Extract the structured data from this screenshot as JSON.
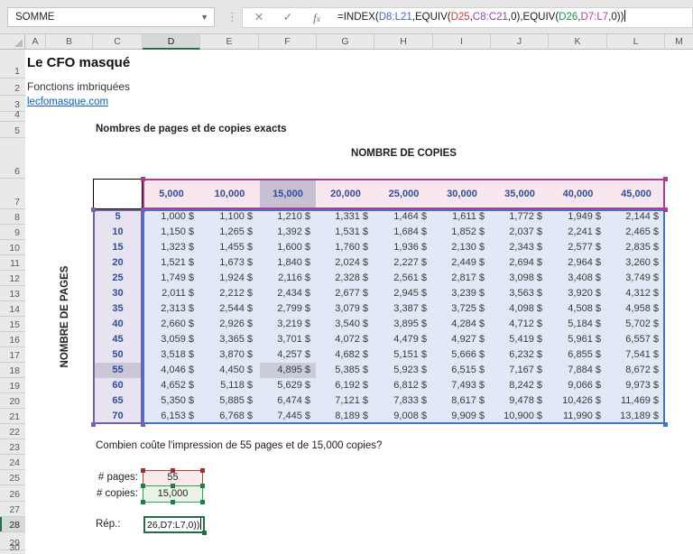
{
  "formula_bar": {
    "name_box_value": "SOMME",
    "segments": [
      {
        "text": "=INDEX(",
        "color": "default"
      },
      {
        "text": "D8:L21",
        "color": "blue"
      },
      {
        "text": ",EQUIV(",
        "color": "default"
      },
      {
        "text": "D25",
        "color": "red"
      },
      {
        "text": ",",
        "color": "default"
      },
      {
        "text": "C8:C21",
        "color": "purple"
      },
      {
        "text": ",0),EQUIV(",
        "color": "default"
      },
      {
        "text": "D26",
        "color": "green"
      },
      {
        "text": ",",
        "color": "default"
      },
      {
        "text": "D7:L7",
        "color": "magenta"
      },
      {
        "text": ",0))",
        "color": "default"
      }
    ]
  },
  "grid": {
    "columns": [
      "A",
      "B",
      "C",
      "D",
      "E",
      "F",
      "G",
      "H",
      "I",
      "J",
      "K",
      "L",
      "M"
    ],
    "selected_column": "D",
    "rows": [
      "1",
      "2",
      "3",
      "4",
      "5",
      "6",
      "7",
      "8",
      "9",
      "10",
      "11",
      "12",
      "13",
      "14",
      "15",
      "16",
      "17",
      "18",
      "19",
      "20",
      "21",
      "22",
      "23",
      "24",
      "25",
      "26",
      "27",
      "28",
      "29",
      "30"
    ],
    "selected_row": "28"
  },
  "sheet": {
    "title": "Le CFO masqué",
    "subtitle": "Fonctions imbriquées",
    "link": "lecfomasque.com",
    "section_heading": "Nombres de pages et de copies exacts",
    "question": "Combien coûte l'impression de 55 pages et de 15,000 copies?",
    "table": {
      "col_axis_label": "NOMBRE DE COPIES",
      "row_axis_label": "NOMBRE DE PAGES",
      "col_headers": [
        "5,000",
        "10,000",
        "15,000",
        "20,000",
        "25,000",
        "30,000",
        "35,000",
        "40,000",
        "45,000"
      ],
      "row_headers": [
        "5",
        "10",
        "15",
        "20",
        "25",
        "30",
        "35",
        "40",
        "45",
        "50",
        "55",
        "60",
        "65",
        "70"
      ],
      "highlighted": {
        "col_header": "15,000",
        "row_header": "55",
        "cell": "4,895 $"
      },
      "data": [
        [
          "1,000 $",
          "1,100 $",
          "1,210 $",
          "1,331 $",
          "1,464 $",
          "1,611 $",
          "1,772 $",
          "1,949 $",
          "2,144 $"
        ],
        [
          "1,150 $",
          "1,265 $",
          "1,392 $",
          "1,531 $",
          "1,684 $",
          "1,852 $",
          "2,037 $",
          "2,241 $",
          "2,465 $"
        ],
        [
          "1,323 $",
          "1,455 $",
          "1,600 $",
          "1,760 $",
          "1,936 $",
          "2,130 $",
          "2,343 $",
          "2,577 $",
          "2,835 $"
        ],
        [
          "1,521 $",
          "1,673 $",
          "1,840 $",
          "2,024 $",
          "2,227 $",
          "2,449 $",
          "2,694 $",
          "2,964 $",
          "3,260 $"
        ],
        [
          "1,749 $",
          "1,924 $",
          "2,116 $",
          "2,328 $",
          "2,561 $",
          "2,817 $",
          "3,098 $",
          "3,408 $",
          "3,749 $"
        ],
        [
          "2,011 $",
          "2,212 $",
          "2,434 $",
          "2,677 $",
          "2,945 $",
          "3,239 $",
          "3,563 $",
          "3,920 $",
          "4,312 $"
        ],
        [
          "2,313 $",
          "2,544 $",
          "2,799 $",
          "3,079 $",
          "3,387 $",
          "3,725 $",
          "4,098 $",
          "4,508 $",
          "4,958 $"
        ],
        [
          "2,660 $",
          "2,926 $",
          "3,219 $",
          "3,540 $",
          "3,895 $",
          "4,284 $",
          "4,712 $",
          "5,184 $",
          "5,702 $"
        ],
        [
          "3,059 $",
          "3,365 $",
          "3,701 $",
          "4,072 $",
          "4,479 $",
          "4,927 $",
          "5,419 $",
          "5,961 $",
          "6,557 $"
        ],
        [
          "3,518 $",
          "3,870 $",
          "4,257 $",
          "4,682 $",
          "5,151 $",
          "5,666 $",
          "6,232 $",
          "6,855 $",
          "7,541 $"
        ],
        [
          "4,046 $",
          "4,450 $",
          "4,895 $",
          "5,385 $",
          "5,923 $",
          "6,515 $",
          "7,167 $",
          "7,884 $",
          "8,672 $"
        ],
        [
          "4,652 $",
          "5,118 $",
          "5,629 $",
          "6,192 $",
          "6,812 $",
          "7,493 $",
          "8,242 $",
          "9,066 $",
          "9,973 $"
        ],
        [
          "5,350 $",
          "5,885 $",
          "6,474 $",
          "7,121 $",
          "7,833 $",
          "8,617 $",
          "9,478 $",
          "10,426 $",
          "11,469 $"
        ],
        [
          "6,153 $",
          "6,768 $",
          "7,445 $",
          "8,189 $",
          "9,008 $",
          "9,909 $",
          "10,900 $",
          "11,990 $",
          "13,189 $"
        ]
      ]
    },
    "inputs": {
      "pages_label": "# pages:",
      "pages_value": "55",
      "copies_label": "# copies:",
      "copies_value": "15,000",
      "answer_label": "Rép.:",
      "answer_editing_value": "26,D7:L7,0))"
    }
  },
  "colors": {
    "data_range_border": "#4472c4",
    "pages_range_border": "#7b5fa8",
    "header_range_border": "#ac3d8c",
    "pages_input_border": "#bf4040",
    "copies_input_border": "#2da44e",
    "active_cell_border": "#1e7145",
    "header_fill": "#f8e7ee",
    "pages_fill": "#e8e3f0",
    "data_fill": "#e0e9f5",
    "highlight_fill": "#c7c0d2",
    "axis_number_text": "#2e4d9e",
    "link_color": "#0b61c2",
    "ref_blue": "#3f66c4",
    "ref_red": "#d03a34",
    "ref_purple": "#8a44ad",
    "ref_green": "#1f9246",
    "ref_magenta": "#b53aa0"
  }
}
